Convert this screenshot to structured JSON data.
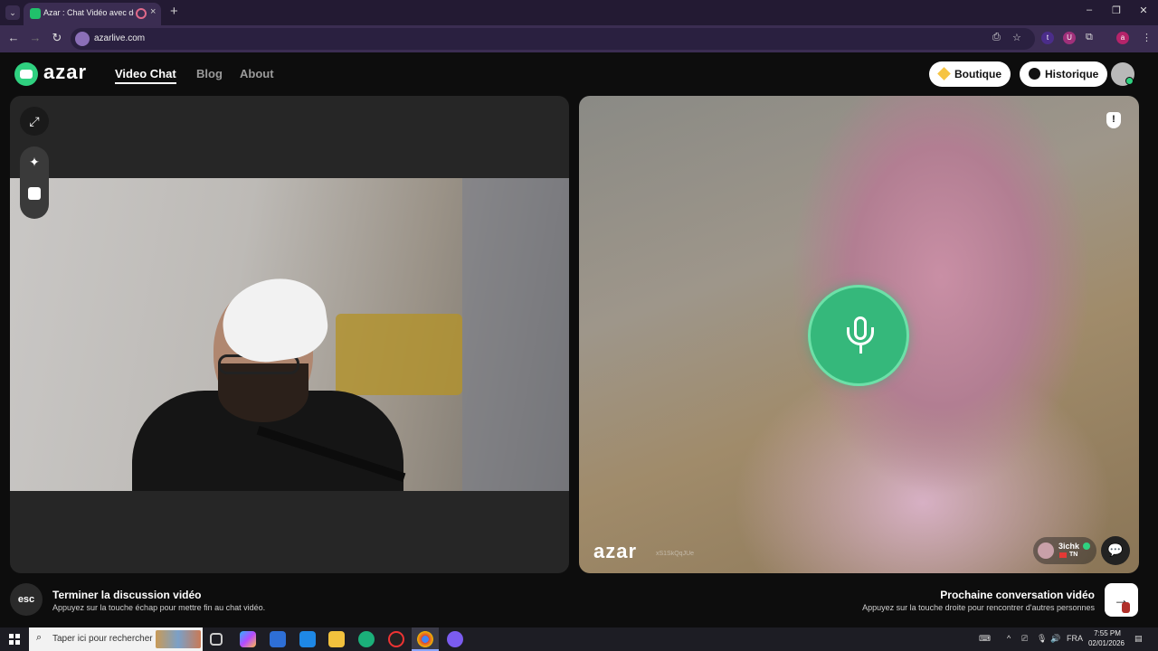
{
  "browser": {
    "tab_title": "Azar : Chat Vidéo avec de n",
    "url": "azarlive.com",
    "new_tab": "+",
    "tab_close": "×"
  },
  "header": {
    "logo": "azar",
    "nav": [
      "Video Chat",
      "Blog",
      "About"
    ],
    "boutique_label": "Boutique",
    "historique_label": "Historique"
  },
  "remote": {
    "logo": "azar",
    "id_text": "xS1SkQqJUe",
    "username": "3ichk",
    "country": "TN"
  },
  "footer": {
    "esc_key": "esc",
    "end_title": "Terminer la discussion vidéo",
    "end_subtitle": "Appuyez sur la touche échap pour mettre fin au chat vidéo.",
    "next_title": "Prochaine conversation vidéo",
    "next_subtitle": "Appuyez sur la touche droite pour rencontrer d'autres personnes",
    "next_arrow": "→"
  },
  "taskbar": {
    "search_placeholder": "Taper ici pour rechercher",
    "language": "FRA",
    "time": "7:55 PM",
    "date": "02/01/2026"
  },
  "colors": {
    "brand_green": "#2fd180",
    "mic_green": "#35b87b",
    "browser_frame": "#3b2d52"
  }
}
